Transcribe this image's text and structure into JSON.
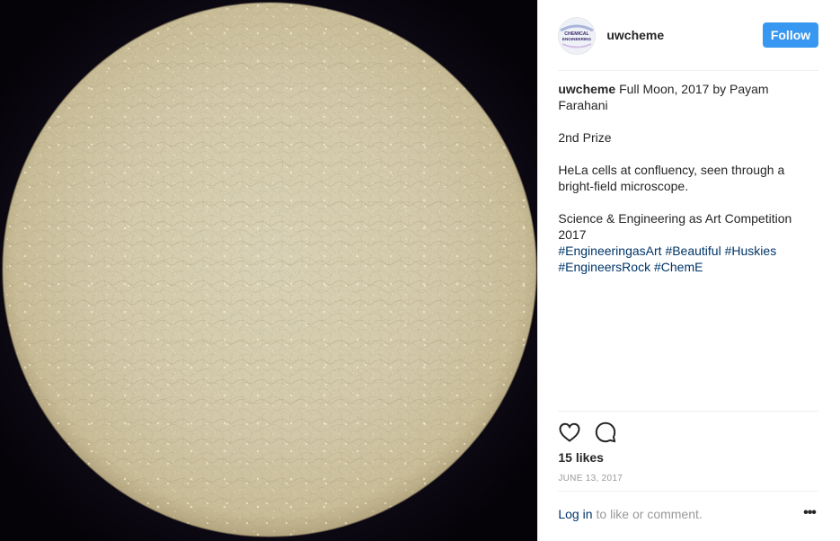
{
  "post": {
    "media_alt": "Full Moon micrograph of HeLa cells",
    "account": {
      "username": "uwcheme",
      "avatar_text_line1": "CHEMICAL",
      "avatar_text_line2": "ENGINEERING"
    },
    "follow_label": "Follow",
    "caption": {
      "username": "uwcheme",
      "title": "Full Moon, 2017 by Payam Farahani",
      "prize": "2nd Prize",
      "description": "HeLa cells at confluency, seen through a bright-field microscope.",
      "competition": "Science & Engineering as Art Competition 2017",
      "hashtags": [
        "#EngineeringasArt",
        "#Beautiful",
        "#Huskies",
        "#EngineersRock",
        "#ChemE"
      ]
    },
    "likes": "15 likes",
    "date": "JUNE 13, 2017",
    "login": {
      "link_label": "Log in",
      "rest": "to like or comment."
    },
    "more_label": "•••",
    "icons": {
      "like": "heart-icon",
      "comment": "comment-icon",
      "more": "more-options-icon"
    },
    "colors": {
      "follow_button": "#3897f0",
      "link": "#003569",
      "muted": "#999999"
    }
  }
}
